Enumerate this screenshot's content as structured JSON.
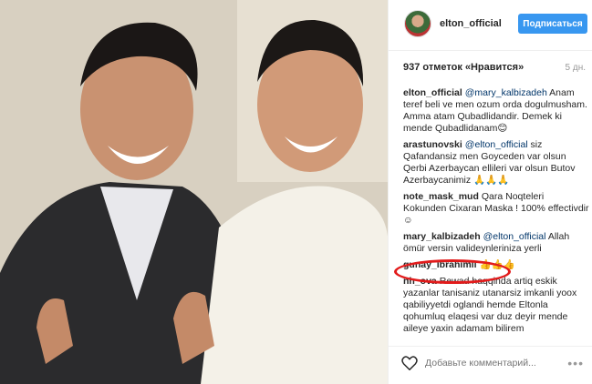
{
  "post": {
    "username": "elton_official",
    "follow_label": "Подписаться",
    "likes_text": "937 отметок «Нравится»",
    "age_text": "5 дн."
  },
  "comments": [
    {
      "author": "elton_official",
      "mention": "@mary_kalbizadeh",
      "text": " Anam teref beli ve men ozum orda dogulmusham. Amma atam Qubadlidandir. Demek ki mende Qubadlidanam😊"
    },
    {
      "author": "arastunovski",
      "mention": "@elton_official",
      "text": " siz Qafandansiz men Goyceden var olsun Qerbi Azerbaycan ellileri var olsun Butov Azerbaycanimiz 🙏🙏🙏"
    },
    {
      "author": "note_mask_mud",
      "mention": "",
      "text": "Qara Noqteleri Kokunden Cixaran Maska ! 100% effectivdir☺"
    },
    {
      "author": "mary_kalbizadeh",
      "mention": "@elton_official",
      "text": " Allah ömür versin valideynleriniza yerli"
    },
    {
      "author": "gunay_ibrahimli",
      "mention": "",
      "text": "👍👍👍"
    },
    {
      "author": "nh_ova",
      "mention": "",
      "text": "Rewad haqqinda artiq eskik yazanlar tanisaniz utanarsiz imkanli yoox qabiliyyetdi oglandi hemde Eltonla qohumluq elaqesi var duz deyir mende aileye yaxin adamam bilirem"
    }
  ],
  "footer": {
    "comment_placeholder": "Добавьте комментарий...",
    "more_glyph": "•••"
  },
  "icons": {
    "heart": "heart-icon",
    "more": "more-options-icon",
    "avatar": "avatar"
  },
  "colors": {
    "accent": "#3897f0",
    "highlight": "#e21b1b"
  }
}
